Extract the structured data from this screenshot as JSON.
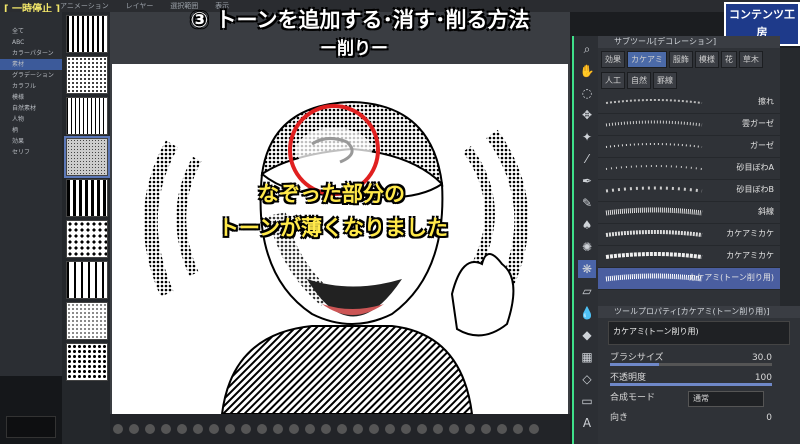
{
  "status": {
    "pause_label": "[ 一時停止 ]"
  },
  "menu_tabs": [
    "アニメーション",
    "レイヤー",
    "選択範囲",
    "表示"
  ],
  "title": "③ トーンを追加する･消す･削る方法",
  "subtitle": "ー削りー",
  "caption": {
    "line1": "なぞった部分の",
    "line2": "トーンが薄くなりました"
  },
  "left_tree": [
    "全て",
    "ABC",
    "カラーパターン",
    "素材",
    "グラデーション",
    "カラフル",
    "模様",
    "自然素材",
    "人物",
    "柄",
    "効果",
    "セリフ"
  ],
  "subtool_panel": {
    "header": "サブツール[デコレーション]",
    "categories": [
      "効果",
      "カケアミ",
      "服飾",
      "模様",
      "花",
      "草木",
      "人工",
      "自然",
      "罫線"
    ],
    "selected_category": "カケアミ",
    "brushes": [
      "擦れ",
      "雲ガーゼ",
      "ガーゼ",
      "砂目ぼわA",
      "砂目ぼわB",
      "斜線",
      "カケアミカケ",
      "カケアミカケ",
      "カケアミ(トーン削り用)"
    ],
    "selected_brush": "カケアミ(トーン削り用)"
  },
  "tool_property": {
    "header": "ツールプロパティ[カケアミ(トーン削り用)]",
    "preview_label": "カケアミ(トーン削り用)",
    "brush_size_label": "ブラシサイズ",
    "brush_size_value": "30.0",
    "brush_size_level": 0.3,
    "opacity_label": "不透明度",
    "opacity_value": "100",
    "opacity_level": 1.0,
    "blend_label": "合成モード",
    "blend_value": "通常",
    "direction_label": "向き",
    "direction_value": "0"
  },
  "logo_text": "コンテンツ工房",
  "colors": {
    "accent_green": "#3fe08a",
    "highlight_red": "#e02020",
    "caption_yellow": "#ffe94a",
    "selection_blue": "#4a64a8"
  }
}
